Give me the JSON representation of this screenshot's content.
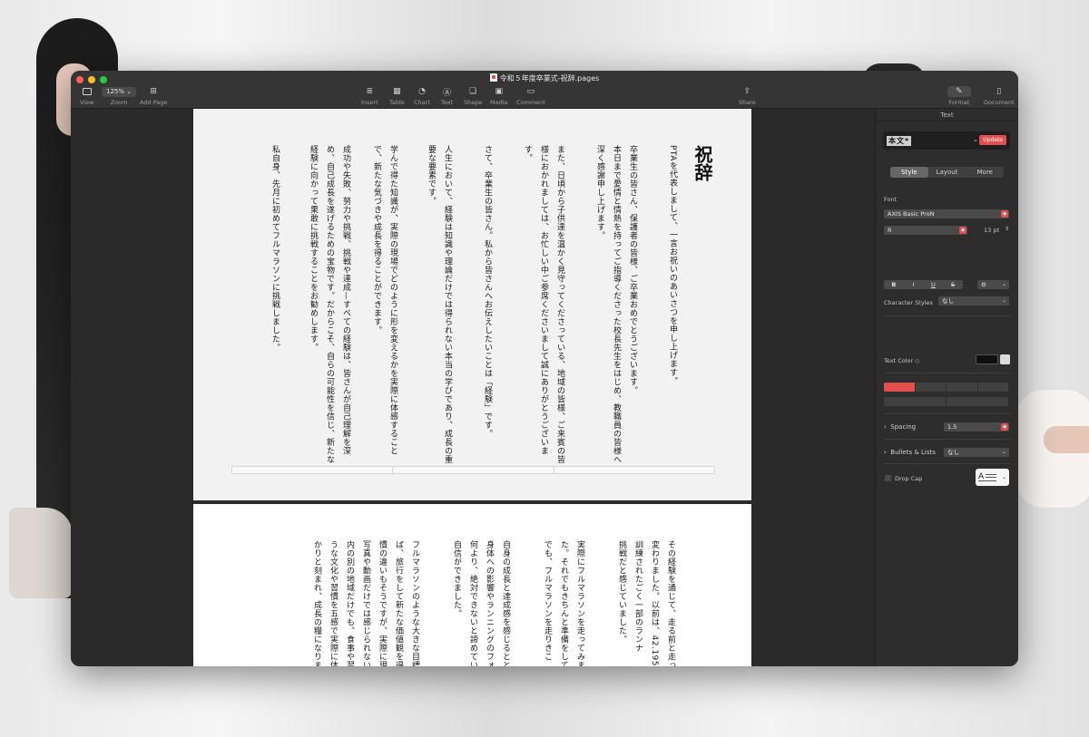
{
  "window": {
    "title": "令和５年度卒業式-祝辞.pages"
  },
  "toolbar": {
    "view": "View",
    "zoom_value": "125%",
    "zoom": "Zoom",
    "add_page": "Add Page",
    "insert": "Insert",
    "table": "Table",
    "chart": "Chart",
    "text": "Text",
    "shape": "Shape",
    "media": "Media",
    "comment": "Comment",
    "share": "Share",
    "format": "Format",
    "document": "Document"
  },
  "document": {
    "title": "祝辞",
    "page1_columns": [
      "PTAを代表しまして、一言お祝いのあいさつを申し上げます。",
      "卒業生の皆さん、保護者の皆様、ご卒業おめでとうございます。",
      "本日まで愛情と情熱を持ってご指導くださった校長先生をはじめ、教職員の皆様へ",
      "深く感謝申し上げます。",
      "また、日頃から子供達を温かく見守ってくださっている、地域の皆様、ご来賓の皆",
      "様におかれましては、お忙しい中ご参席くださいまして誠にありがとうございま",
      "す。",
      "さて、卒業生の皆さん。私から皆さんへお伝えしたいことは「経験」です。",
      "人生において、経験は知識や理論だけでは得られない本当の学びであり、成長の重",
      "要な要素です。",
      "学んで得た知識が、実際の現場でどのように形を変えるかを実際に体感すること",
      "で、新たな気づきや成長を得ることができます。",
      "成功や失敗、努力や挑戦、挑戦や達成—すべての経験は、皆さんが自己理解を深",
      "め、自己成長を遂げるための宝物です。だからこそ、自らの可能性を信じ、新たな",
      "経験に向かって果敢に挑戦することをお勧めします。",
      "私自身、先月に初めてフルマラソンに挑戦しました。"
    ],
    "page2_columns": [
      "その経験を通じて、走る前と走っ",
      "変わりました。以前は、42.195",
      "訓練されたごく一部のランナ",
      "挑戦だと感じていました。",
      "実際にフルマラソンを走ってみま",
      "た。それでもきちんと準備をして",
      "でも、フルマラソンを走りきこ",
      "自身の成長と達成感を感じるとと",
      "身体への影響やランニングのフォ",
      "何より、絶対できないと諦めてい",
      "自信ができました。",
      "フルマラソンのような大きな目標",
      "ば、旅行をして新たな価値観を得",
      "慣の違いもそうですが、実際に現",
      "写真や動画だけでは感じられない",
      "内の別の地域だけでも、食事や習",
      "うな文化や習慣を五感で実際に体",
      "かりと刻まれ、成長の糧になりま"
    ]
  },
  "inspector": {
    "header": "Text",
    "paragraph_style": "本文*",
    "update": "Update",
    "tabs": [
      "Style",
      "Layout",
      "More"
    ],
    "font_label": "Font",
    "font_name": "AXIS Basic ProN",
    "font_weight": "R",
    "font_size": "13 pt",
    "bold": "B",
    "italic": "I",
    "underline": "U",
    "strike": "S",
    "char_styles_label": "Character Styles",
    "char_styles_value": "なし",
    "text_color_label": "Text Color ◇",
    "spacing_label": "Spacing",
    "spacing_value": "1.5",
    "bullets_label": "Bullets & Lists",
    "bullets_value": "なし",
    "dropcap_label": "Drop Cap",
    "dropcap_preview": "A"
  },
  "colors": {
    "accent": "#e14f4f",
    "window_bg": "#2a2a2a",
    "page_bg": "#f2f2f2"
  }
}
